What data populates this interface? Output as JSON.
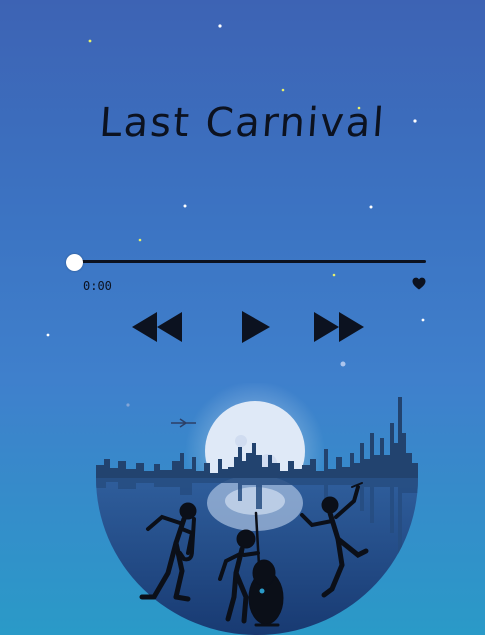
{
  "song": {
    "title": "Last Carnival"
  },
  "player": {
    "current_time": "0:00",
    "progress": 0
  },
  "controls": {
    "rewind_icon": "rewind-icon",
    "play_icon": "play-icon",
    "forward_icon": "fast-forward-icon",
    "favorite_icon": "heart-icon"
  },
  "colors": {
    "sky_top": "#3d63b4",
    "sky_bottom": "#2a9ac8",
    "ink": "#0c1220",
    "moon": "#dfe9f7"
  }
}
